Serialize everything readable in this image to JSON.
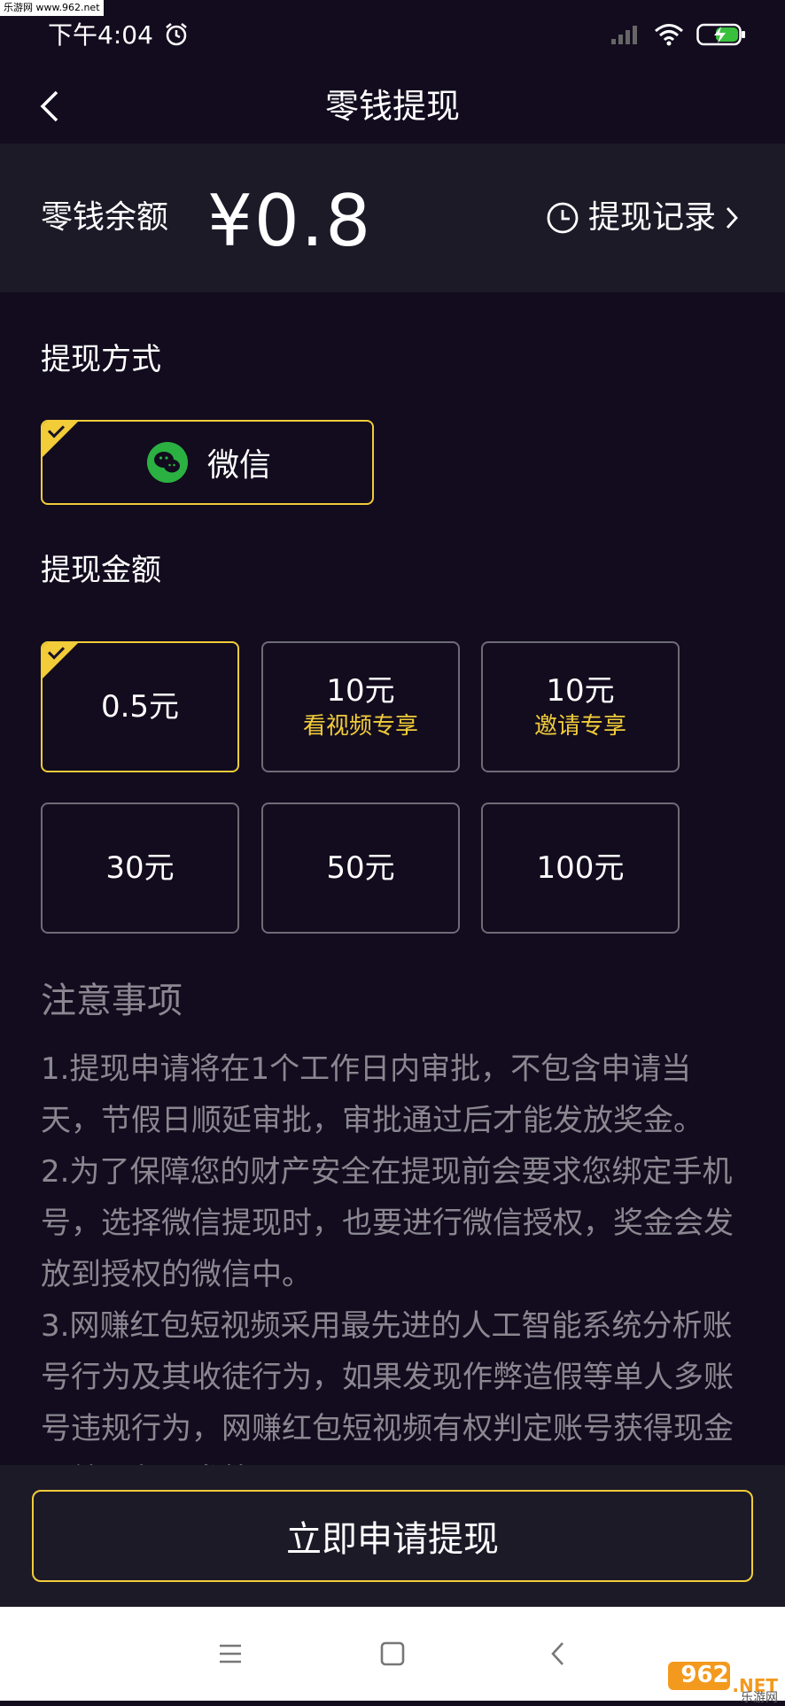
{
  "watermark": {
    "top_text": "乐游网 www.962.net",
    "logo_main": "962",
    "logo_suffix": ".NET",
    "logo_cn": "乐游网"
  },
  "status_bar": {
    "time": "下午4:04"
  },
  "header": {
    "title": "零钱提现"
  },
  "balance": {
    "label": "零钱余额",
    "amount": "¥0.8",
    "records_label": "提现记录"
  },
  "method": {
    "section_title": "提现方式",
    "option_label": "微信"
  },
  "amounts": {
    "section_title": "提现金额",
    "options": [
      {
        "value": "0.5元",
        "sub": ""
      },
      {
        "value": "10元",
        "sub": "看视频专享"
      },
      {
        "value": "10元",
        "sub": "邀请专享"
      },
      {
        "value": "30元",
        "sub": ""
      },
      {
        "value": "50元",
        "sub": ""
      },
      {
        "value": "100元",
        "sub": ""
      }
    ]
  },
  "notes": {
    "title": "注意事项",
    "items": [
      "1.提现申请将在1个工作日内审批，不包含申请当天，节假日顺延审批，审批通过后才能发放奖金。",
      "2.为了保障您的财产安全在提现前会要求您绑定手机号，选择微信提现时，也要进行微信授权，奖金会发放到授权的微信中。",
      "3.网赚红包短视频采用最先进的人工智能系统分析账号行为及其收徒行为，如果发现作弊造假等单人多账号违规行为，网赚红包短视频有权判定账号获得现金无效，永不发放。"
    ]
  },
  "actions": {
    "apply_label": "立即申请提现"
  },
  "colors": {
    "accent": "#f2cc39",
    "background": "#120c1e",
    "card": "#1d1a28",
    "wechat": "#2bb141"
  }
}
